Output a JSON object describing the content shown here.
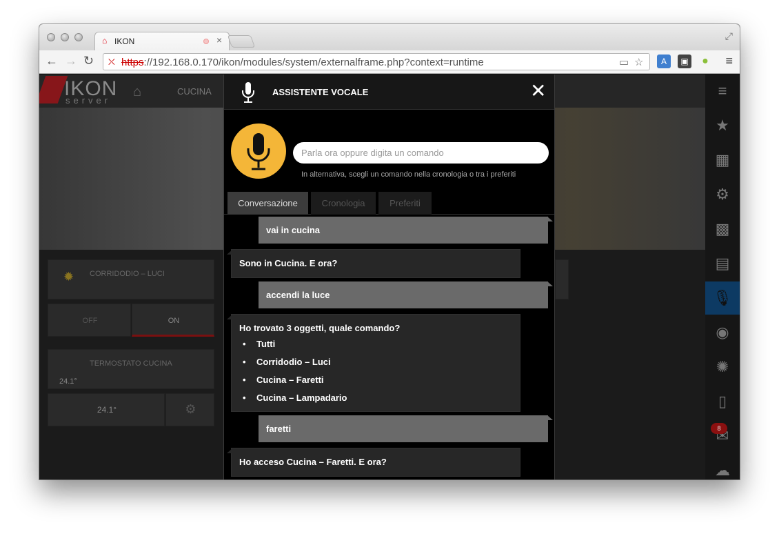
{
  "browser": {
    "tab_title": "IKON",
    "url_scheme": "https",
    "url_rest": "://192.168.0.170/ikon/modules/system/externalframe.php?context=runtime",
    "url_host": "192.168.0.170"
  },
  "app": {
    "logo": "IKON",
    "logo_sub": "server",
    "room": "CUCINA",
    "widgets": {
      "corridoio_title": "CORRIDODIO – LUCI",
      "off_label": "OFF",
      "on_label": "ON",
      "termostato_title": "TERMOSTATO CUCINA",
      "temp_small": "24.1°",
      "temp_large": "24.1°"
    },
    "notification_count": "8"
  },
  "dialog": {
    "title": "ASSISTENTE VOCALE",
    "input_placeholder": "Parla ora oppure digita un comando",
    "hint": "In alternativa, scegli un comando nella cronologia o tra i preferiti",
    "tabs": [
      "Conversazione",
      "Cronologia",
      "Preferiti"
    ],
    "active_tab": "Conversazione",
    "messages": [
      {
        "from": "user",
        "text": "vai in cucina"
      },
      {
        "from": "bot",
        "text": "Sono in Cucina. E ora?"
      },
      {
        "from": "user",
        "text": "accendi la luce"
      },
      {
        "from": "bot",
        "text": "Ho trovato 3 oggetti, quale comando?",
        "options": [
          "Tutti",
          "Corridodio – Luci",
          "Cucina – Faretti",
          "Cucina – Lampadario"
        ]
      },
      {
        "from": "user",
        "text": "faretti"
      },
      {
        "from": "bot",
        "text": "Ho acceso Cucina – Faretti. E ora?"
      }
    ]
  },
  "colors": {
    "mic_circle": "#f4b638",
    "user_bubble": "#6a6a6a",
    "bot_bubble": "#272727",
    "active_rail": "#0d3a63",
    "url_https": "#cc0000"
  }
}
